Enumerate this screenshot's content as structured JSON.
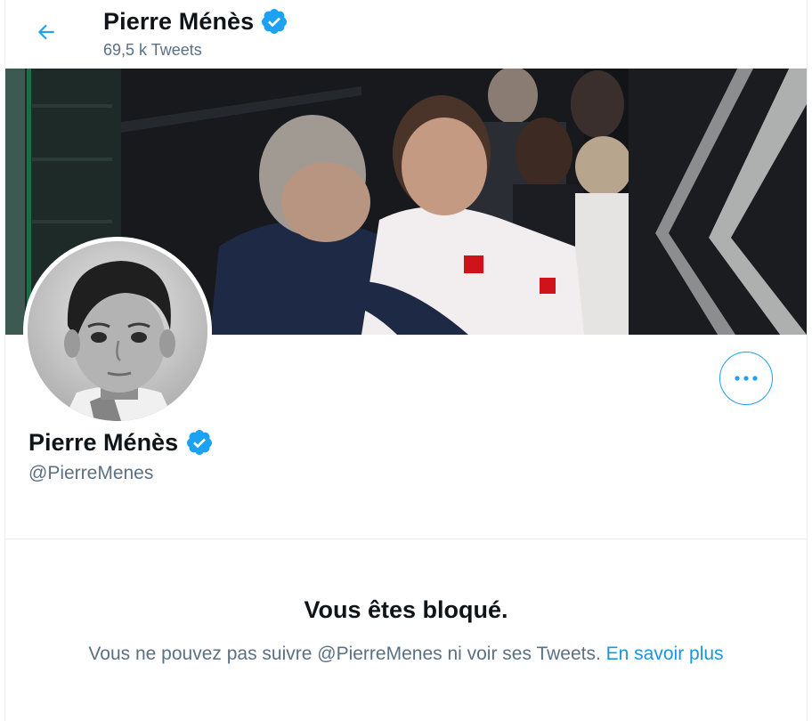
{
  "header": {
    "name": "Pierre Ménès",
    "tweet_count": "69,5 k Tweets"
  },
  "profile": {
    "name": "Pierre Ménès",
    "handle": "@PierreMenes",
    "verified": true
  },
  "blocked": {
    "title": "Vous êtes bloqué.",
    "message": "Vous ne pouvez pas suivre @PierreMenes ni voir ses Tweets.",
    "link_label": "En savoir plus"
  },
  "colors": {
    "accent": "#1da1f2",
    "link": "#1b95e0",
    "secondary_text": "#5b7083",
    "primary_text": "#0f1419"
  },
  "icons": {
    "back": "arrow-left-icon",
    "verified": "verified-badge-icon",
    "more": "more-dots-icon"
  }
}
